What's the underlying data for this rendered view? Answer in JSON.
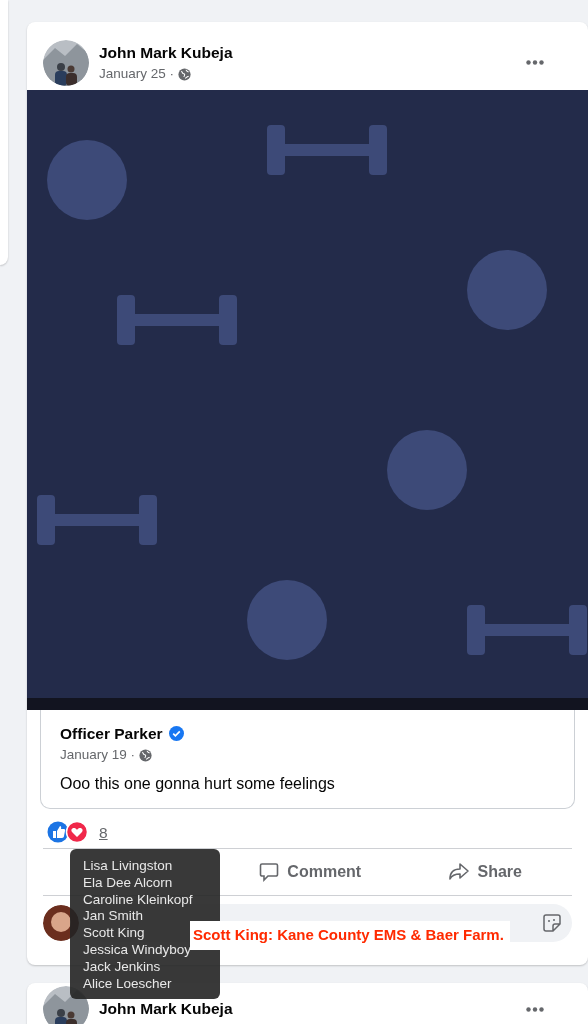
{
  "post": {
    "author": "John Mark Kubeja",
    "date": "January 25 ·",
    "shared": {
      "author": "Officer Parker",
      "verified": true,
      "date": "January 19 ·",
      "text": "Ooo this one gonna hurt some feelings"
    },
    "reaction_count": "8",
    "actions": [
      {
        "kind": "comment",
        "label": "Comment"
      },
      {
        "kind": "share",
        "label": "Share"
      }
    ]
  },
  "reactors_tooltip": [
    "Lisa Livingston",
    "Ela Dee Alcorn",
    "Caroline Kleinkopf",
    "Jan Smith",
    "Scott King",
    "Jessica Windyboy",
    "Jack Jenkins",
    "Alice Loescher"
  ],
  "annotation": "Scott King:  Kane County EMS & Baer Farm.",
  "next_post": {
    "author": "John Mark Kubeja"
  }
}
